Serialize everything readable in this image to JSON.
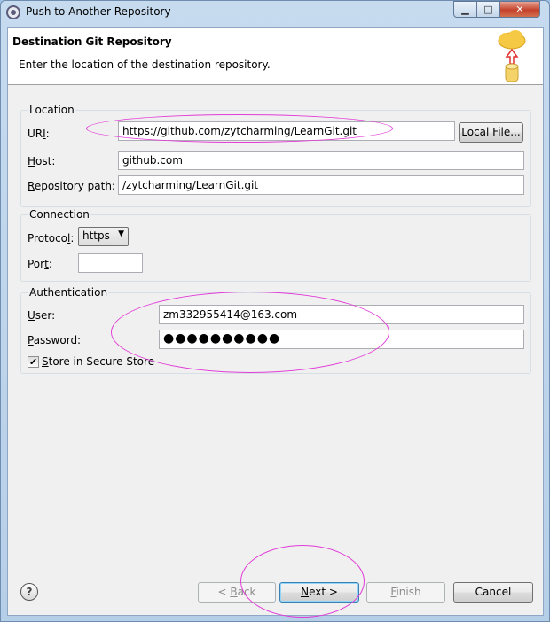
{
  "window": {
    "title": "Push to Another Repository",
    "minimize_glyph": "▁",
    "maximize_glyph": "□",
    "close_glyph": "✕"
  },
  "banner": {
    "title": "Destination Git Repository",
    "message": "Enter the location of the destination repository."
  },
  "location": {
    "group_title": "Location",
    "uri_label_pre": "UR",
    "uri_label_acc": "I",
    "uri_label_post": ":",
    "uri_value": "https://github.com/zytcharming/LearnGit.git",
    "local_file_label": "Local File...",
    "host_label_acc": "H",
    "host_label_post": "ost:",
    "host_value": "github.com",
    "repo_path_label_acc": "R",
    "repo_path_label_post": "epository path:",
    "repo_path_value": "/zytcharming/LearnGit.git"
  },
  "connection": {
    "group_title": "Connection",
    "protocol_label_pre": "Protoco",
    "protocol_label_acc": "l",
    "protocol_label_post": ":",
    "protocol_value": "https",
    "port_label_pre": "Por",
    "port_label_acc": "t",
    "port_label_post": ":",
    "port_value": ""
  },
  "authentication": {
    "group_title": "Authentication",
    "user_label_acc": "U",
    "user_label_post": "ser:",
    "user_value": "zm332955414@163.com",
    "password_label_acc": "P",
    "password_label_post": "assword:",
    "password_value": "●●●●●●●●●●",
    "store_label_acc": "S",
    "store_label_post": "tore in Secure Store",
    "store_checked_glyph": "✔"
  },
  "footer": {
    "help_glyph": "?",
    "back_pre": "< ",
    "back_acc": "B",
    "back_post": "ack",
    "next_acc": "N",
    "next_post": "ext >",
    "finish_acc": "F",
    "finish_post": "inish",
    "cancel_label": "Cancel"
  },
  "colors": {
    "annotation": "#e23bd8",
    "cloud": "#f6c944",
    "arrow": "#e03030"
  }
}
